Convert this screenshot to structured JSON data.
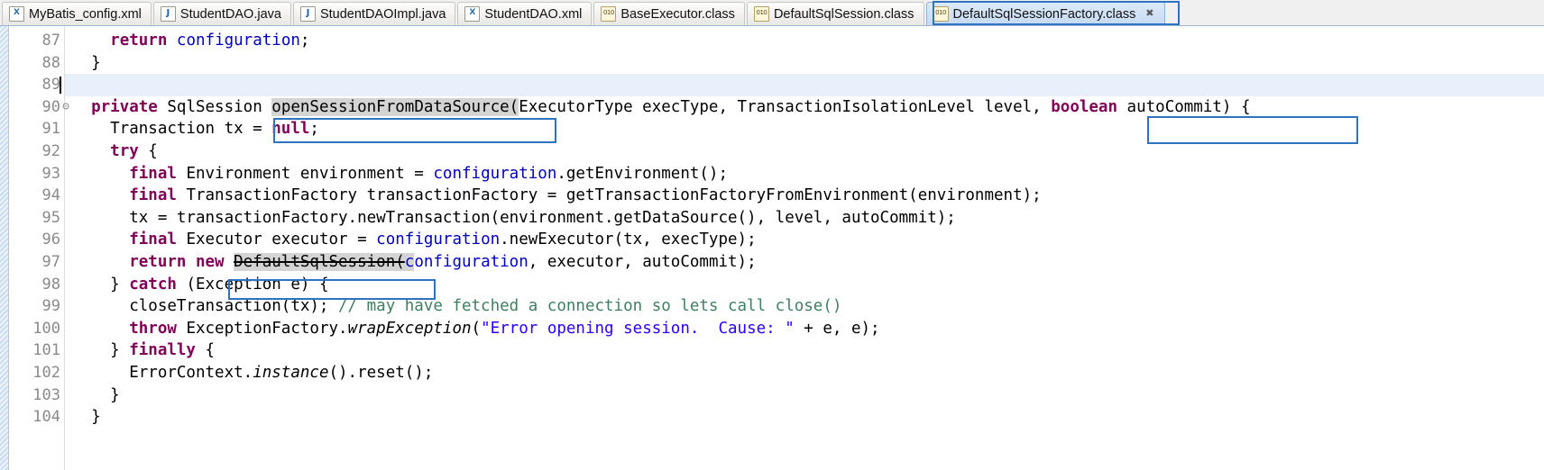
{
  "window": {
    "type": "eclipse-java-editor"
  },
  "tabs": [
    {
      "label": "MyBatis_config.xml",
      "icon": "xml-file-icon",
      "icon_glyph": "X",
      "icon_kind": "xml",
      "active": false,
      "closable": false
    },
    {
      "label": "StudentDAO.java",
      "icon": "java-file-icon",
      "icon_glyph": "J",
      "icon_kind": "java",
      "active": false,
      "closable": false
    },
    {
      "label": "StudentDAOImpl.java",
      "icon": "java-file-icon",
      "icon_glyph": "J",
      "icon_kind": "java",
      "active": false,
      "closable": false
    },
    {
      "label": "StudentDAO.xml",
      "icon": "xml-file-icon",
      "icon_glyph": "X",
      "icon_kind": "xml",
      "active": false,
      "closable": false
    },
    {
      "label": "BaseExecutor.class",
      "icon": "class-file-icon",
      "icon_glyph": "010",
      "icon_kind": "cls",
      "active": false,
      "closable": false
    },
    {
      "label": "DefaultSqlSession.class",
      "icon": "class-file-icon",
      "icon_glyph": "010",
      "icon_kind": "cls",
      "active": false,
      "closable": false
    },
    {
      "label": "DefaultSqlSessionFactory.class",
      "icon": "class-file-icon",
      "icon_glyph": "010",
      "icon_kind": "cls",
      "active": true,
      "closable": true,
      "close_glyph": "✖"
    }
  ],
  "colors": {
    "annotation_box": "#2f72c0",
    "keyword": "#7f0055",
    "field": "#0000c0",
    "string": "#2a00ff",
    "comment": "#3f7f5f",
    "occurrence_highlight": "#d4d4d4",
    "caret_line": "#e8f0fb",
    "active_tab": "#cfe1f5"
  },
  "editor": {
    "first_line_number": 87,
    "last_line_number": 104,
    "caret_line_number": 89,
    "fold_marker_line": 90,
    "fold_glyph": "⊝",
    "gutter_numbers": [
      "87",
      "88",
      "89",
      "90",
      "91",
      "92",
      "93",
      "94",
      "95",
      "96",
      "97",
      "98",
      "99",
      "100",
      "101",
      "102",
      "103",
      "104"
    ],
    "lines": [
      {
        "n": "87",
        "text": "    return configuration;"
      },
      {
        "n": "88",
        "text": "  }"
      },
      {
        "n": "89",
        "text": ""
      },
      {
        "n": "90",
        "text": "  private SqlSession openSessionFromDataSource(ExecutorType execType, TransactionIsolationLevel level, boolean autoCommit) {"
      },
      {
        "n": "91",
        "text": "    Transaction tx = null;"
      },
      {
        "n": "92",
        "text": "    try {"
      },
      {
        "n": "93",
        "text": "      final Environment environment = configuration.getEnvironment();"
      },
      {
        "n": "94",
        "text": "      final TransactionFactory transactionFactory = getTransactionFactoryFromEnvironment(environment);"
      },
      {
        "n": "95",
        "text": "      tx = transactionFactory.newTransaction(environment.getDataSource(), level, autoCommit);"
      },
      {
        "n": "96",
        "text": "      final Executor executor = configuration.newExecutor(tx, execType);"
      },
      {
        "n": "97",
        "text": "      return new DefaultSqlSession(configuration, executor, autoCommit);"
      },
      {
        "n": "98",
        "text": "    } catch (Exception e) {"
      },
      {
        "n": "99",
        "text": "      closeTransaction(tx); // may have fetched a connection so lets call close()"
      },
      {
        "n": "100",
        "text": "      throw ExceptionFactory.wrapException(\"Error opening session.  Cause: \" + e, e);"
      },
      {
        "n": "101",
        "text": "    } finally {"
      },
      {
        "n": "102",
        "text": "      ErrorContext.instance().reset();"
      },
      {
        "n": "103",
        "text": "    }"
      },
      {
        "n": "104",
        "text": "  }"
      }
    ]
  },
  "code_tokens": {
    "l87_kw_return": "return",
    "l87_fld": "configuration",
    "l87_semi": ";",
    "l88": "  }",
    "l90_kw_private": "private",
    "l90_type": " SqlSession ",
    "l90_method": "openSessionFromDataSource(",
    "l90_params1": "ExecutorType execType, TransactionIsolationLevel level,",
    "l90_kw_boolean": "boolean",
    "l90_autocommit": " autoCommit",
    "l90_tail": ") {",
    "l91_a": "    Transaction tx = ",
    "l91_kw_null": "null",
    "l91_b": ";",
    "l92_kw_try": "try",
    "l92_b": " {",
    "l93_kw_final": "final",
    "l93_a": " Environment environment = ",
    "l93_fld": "configuration",
    "l93_b": ".getEnvironment();",
    "l94_kw_final": "final",
    "l94_a": " TransactionFactory transactionFactory = getTransactionFactoryFromEnvironment(environment);",
    "l95_a": "      tx = transactionFactory.newTransaction(environment.getDataSource(), level, autoCommit);",
    "l96_kw_final": "final",
    "l96_a": " Executor executor = ",
    "l96_fld": "configuration",
    "l96_b": ".newExecutor(tx, execType);",
    "l97_kw_return": "return",
    "l97_kw_new": " new ",
    "l97_cls": "DefaultSqlSession(",
    "l97_c": "c",
    "l97_fld": "onfiguration",
    "l97_b": ", executor, autoCommit);",
    "l98_a": "    } ",
    "l98_kw_catch": "catch",
    "l98_b": " (Exception e) {",
    "l99_a": "      closeTransaction(tx); ",
    "l99_cmt": "// may have fetched a connection so lets call close()",
    "l100_a": "      ",
    "l100_kw_throw": "throw",
    "l100_b": " ExceptionFactory.",
    "l100_m": "wrapException",
    "l100_c": "(",
    "l100_str": "\"Error opening session.  Cause: \"",
    "l100_d": " + e, e);",
    "l101_a": "    } ",
    "l101_kw_finally": "finally",
    "l101_b": " {",
    "l102_a": "      ErrorContext.",
    "l102_m": "instance",
    "l102_b": "().reset();",
    "l103": "    }",
    "l104": "  }"
  },
  "annotations": [
    {
      "name": "method-name-box",
      "target": "openSessionFromDataSource("
    },
    {
      "name": "boolean-param-box",
      "target": "boolean autoCommit"
    },
    {
      "name": "constructor-box",
      "target": "DefaultSqlSession(c"
    },
    {
      "name": "active-tab-box",
      "target": "DefaultSqlSessionFactory.class"
    }
  ]
}
